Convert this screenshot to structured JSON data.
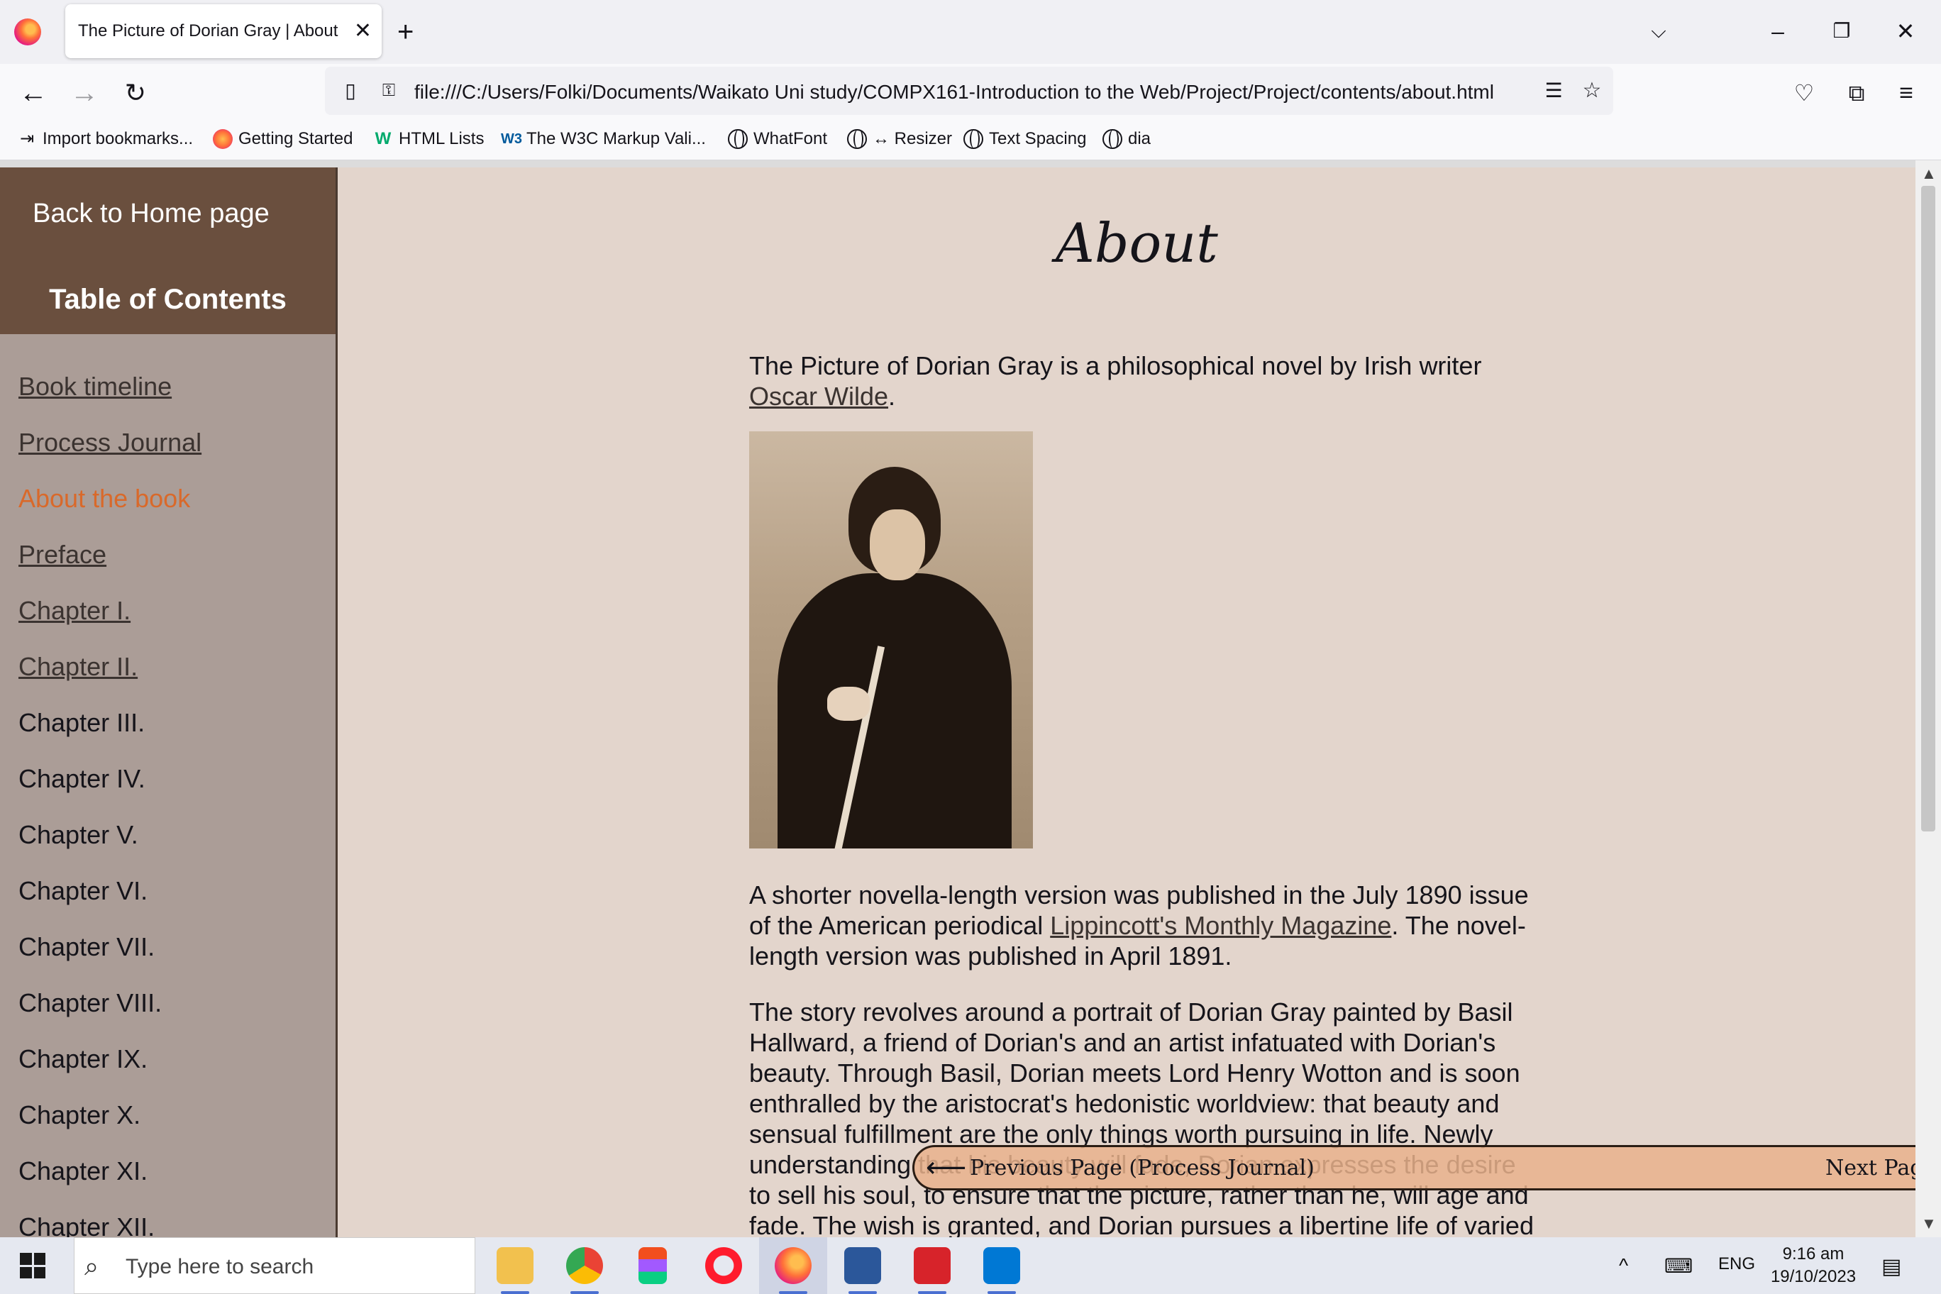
{
  "browser": {
    "tab_title": "The Picture of Dorian Gray | About",
    "url": "file:///C:/Users/Folki/Documents/Waikato Uni study/COMPX161-Introduction to the Web/Project/Project/contents/about.html",
    "bookmarks": [
      "Import bookmarks...",
      "Getting Started",
      "HTML Lists",
      "The W3C Markup Vali...",
      "WhatFont",
      "↔ Resizer",
      "Text Spacing",
      "dia"
    ]
  },
  "sidebar": {
    "back_link": "Back to Home page",
    "toc_title": "Table of Contents",
    "items": [
      {
        "label": "Book timeline",
        "state": "link"
      },
      {
        "label": "Process Journal",
        "state": "link"
      },
      {
        "label": "About the book",
        "state": "active"
      },
      {
        "label": "Preface",
        "state": "link"
      },
      {
        "label": "Chapter I.",
        "state": "link"
      },
      {
        "label": "Chapter II.",
        "state": "link"
      },
      {
        "label": "Chapter III.",
        "state": "plain"
      },
      {
        "label": "Chapter IV.",
        "state": "plain"
      },
      {
        "label": "Chapter V.",
        "state": "plain"
      },
      {
        "label": "Chapter VI.",
        "state": "plain"
      },
      {
        "label": "Chapter VII.",
        "state": "plain"
      },
      {
        "label": "Chapter VIII.",
        "state": "plain"
      },
      {
        "label": "Chapter IX.",
        "state": "plain"
      },
      {
        "label": "Chapter X.",
        "state": "plain"
      },
      {
        "label": "Chapter XI.",
        "state": "plain"
      },
      {
        "label": "Chapter XII.",
        "state": "plain"
      }
    ]
  },
  "main": {
    "title": "About",
    "intro_text": "The Picture of Dorian Gray is a philosophical novel by Irish writer ",
    "intro_link": "Oscar Wilde",
    "intro_end": ".",
    "para2_text1": "A shorter novella-length version was published in the July 1890 issue of the American periodical ",
    "para2_link": "Lippincott's Monthly Magazine",
    "para2_text2": ". The novel-length version was published in April 1891.",
    "para3": "The story revolves around a portrait of Dorian Gray painted by Basil Hallward, a friend of Dorian's and an artist infatuated with Dorian's beauty. Through Basil, Dorian meets Lord Henry Wotton and is soon enthralled by the aristocrat's hedonistic worldview: that beauty and sensual fulfillment are the only things worth pursuing in life. Newly understanding that his beauty will fade, Dorian expresses the desire to sell his soul, to ensure that the picture, rather than he, will age and fade. The wish is granted, and Dorian pursues a libertine life of varied"
  },
  "pager": {
    "prev_label": "Previous Page (Process Journal)",
    "next_label": "Next Page (Preface)"
  },
  "taskbar": {
    "search_placeholder": "Type here to search",
    "language": "ENG",
    "time": "9:16 am",
    "date": "19/10/2023"
  }
}
